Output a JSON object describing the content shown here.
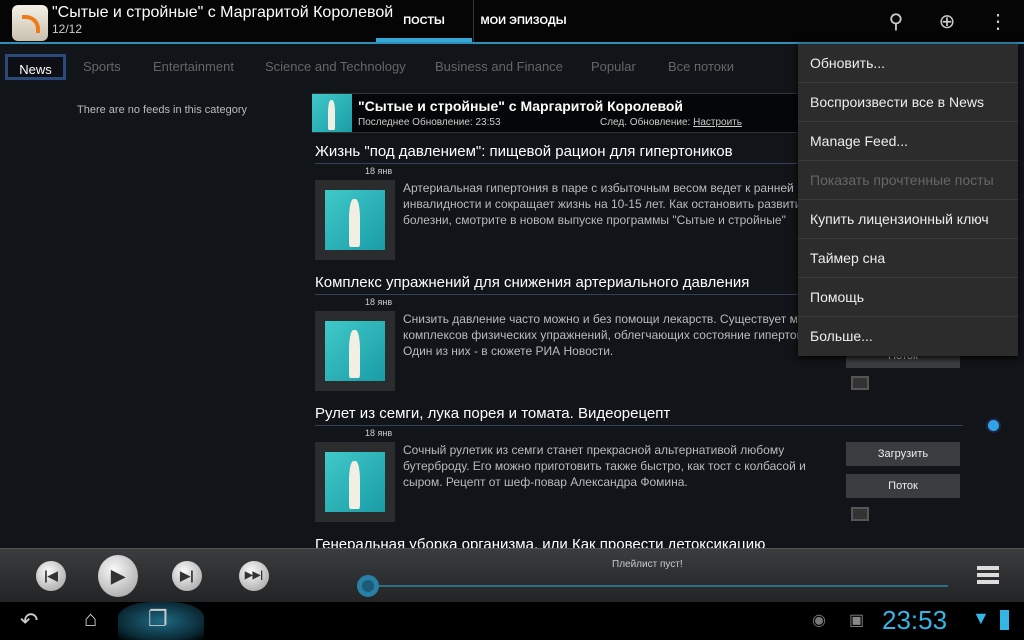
{
  "app": {
    "title": "\"Сытые и стройные\" с Маргаритой Королевой",
    "count": "12/12"
  },
  "tabs": [
    {
      "label": "ПОСТЫ",
      "active": true
    },
    {
      "label": "МОИ ЭПИЗОДЫ",
      "active": false
    }
  ],
  "actions": {
    "search": "search-icon",
    "add": "add-icon",
    "overflow": "overflow-icon"
  },
  "categories": [
    "News",
    "Sports",
    "Entertainment",
    "Science and Technology",
    "Business and Finance",
    "Popular",
    "Все потоки"
  ],
  "left_pane": {
    "empty": "There are no feeds in this category"
  },
  "feed": {
    "title": "\"Сытые и стройные\" с Маргаритой Королевой",
    "last_update": "Последнее Обновление: 23:53",
    "next_update": "След. Обновление:",
    "configure": "Настроить"
  },
  "items": [
    {
      "title": "Жизнь \"под давлением\": пищевой рацион для гипертоников",
      "date": "18 янв",
      "desc": "Артериальная гипертония в паре с избыточным весом ведет к ранней инвалидности и сокращает жизнь на 10-15 лет. Как остановить развитие болезни, смотрите в новом выпуске программы \"Сытые и стройные\""
    },
    {
      "title": "Комплекс упражнений для снижения артериального давления",
      "date": "18 янв",
      "desc": "Снизить давление часто можно и без помощи лекарств. Существует масса комплексов физических упражнений, облегчающих состояние гипертоников. Один из них - в сюжете РИА Новости."
    },
    {
      "title": "Рулет из семги, лука порея и томата. Видеорецепт",
      "date": "18 янв",
      "desc": "Сочный рулетик из семги станет прекрасной альтернативой любому бутерброду. Его можно приготовить также быстро, как тост с колбасой и сыром. Рецепт от шеф-повар Александра Фомина."
    },
    {
      "title": "Генеральная уборка организма, или Как провести детоксикацию"
    }
  ],
  "buttons": {
    "download": "Загрузить",
    "stream": "Поток"
  },
  "menu": [
    {
      "label": "Обновить...",
      "enabled": true
    },
    {
      "label": "Воспроизвести все в News",
      "enabled": true
    },
    {
      "label": "Manage Feed...",
      "enabled": true
    },
    {
      "label": "Показать прочтенные посты",
      "enabled": false
    },
    {
      "label": "Купить лицензионный ключ",
      "enabled": true
    },
    {
      "label": "Таймер сна",
      "enabled": true
    },
    {
      "label": "Помощь",
      "enabled": true
    },
    {
      "label": "Больше...",
      "enabled": true
    }
  ],
  "player": {
    "status": "Плейлист пуст!",
    "progress": 0
  },
  "status_bar": {
    "time": "23:53"
  },
  "colors": {
    "accent": "#33b5e5"
  }
}
